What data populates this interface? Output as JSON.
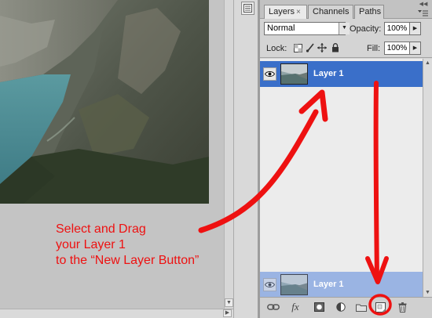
{
  "panel": {
    "tabs": [
      {
        "label": "Layers",
        "close": "×"
      },
      {
        "label": "Channels"
      },
      {
        "label": "Paths"
      }
    ],
    "blend_mode": {
      "selected": "Normal"
    },
    "opacity": {
      "label": "Opacity:",
      "value": "100%"
    },
    "lock": {
      "label": "Lock:"
    },
    "fill": {
      "label": "Fill:",
      "value": "100%"
    },
    "layers": [
      {
        "name": "Layer 1",
        "state": "selected"
      },
      {
        "name": "Layer 1",
        "state": "dragged"
      }
    ],
    "bottom_icons": [
      "link-layers-icon",
      "fx-layer-style-icon",
      "add-mask-icon",
      "adjustment-layer-icon",
      "new-group-folder-icon",
      "new-layer-icon",
      "trash-icon"
    ],
    "fx_label": "fx"
  },
  "annotation": {
    "lines": [
      "Select and Drag",
      "your Layer 1",
      "to the “New Layer Button”"
    ],
    "color": "#ee1111"
  },
  "colors": {
    "selected_layer": "#3a6fc9",
    "dragged_layer": "#9ab4e3",
    "panel_bg": "#d4d4d4",
    "canvas_bg": "#c4c4c4"
  }
}
